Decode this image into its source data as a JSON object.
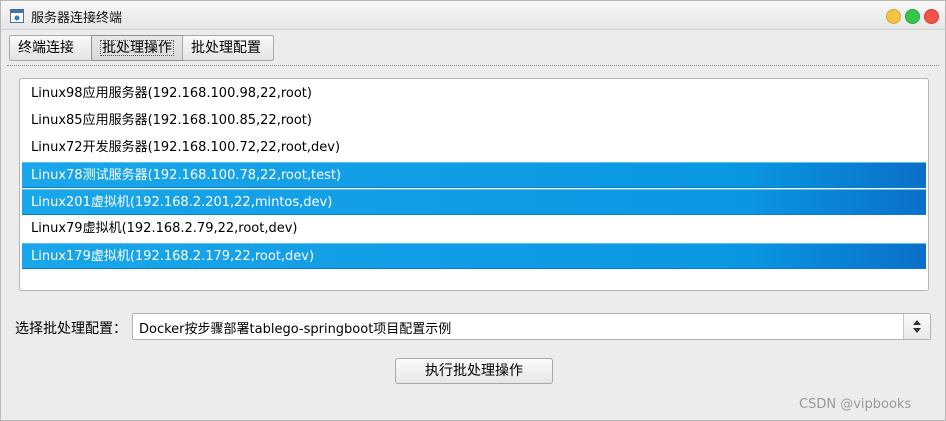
{
  "window": {
    "title": "服务器连接终端"
  },
  "tabs": [
    {
      "label": "终端连接"
    },
    {
      "label": "批处理操作",
      "active": true
    },
    {
      "label": "批处理配置"
    }
  ],
  "servers": [
    {
      "label": "Linux98应用服务器(192.168.100.98,22,root)",
      "selected": false
    },
    {
      "label": "Linux85应用服务器(192.168.100.85,22,root)",
      "selected": false
    },
    {
      "label": "Linux72开发服务器(192.168.100.72,22,root,dev)",
      "selected": false
    },
    {
      "label": "Linux78测试服务器(192.168.100.78,22,root,test)",
      "selected": true
    },
    {
      "label": "Linux201虚拟机(192.168.2.201,22,mintos,dev)",
      "selected": true
    },
    {
      "label": "Linux79虚拟机(192.168.2.79,22,root,dev)",
      "selected": false
    },
    {
      "label": "Linux179虚拟机(192.168.2.179,22,root,dev)",
      "selected": true
    }
  ],
  "batch_config": {
    "label": "选择批处理配置：",
    "selected_value": "Docker按步骤部署tablego-springboot项目配置示例"
  },
  "run_button": {
    "label": "执行批处理操作"
  },
  "watermark": "CSDN @vipbooks",
  "colors": {
    "selection": "#0a97e2",
    "window_bg": "#ececec"
  }
}
